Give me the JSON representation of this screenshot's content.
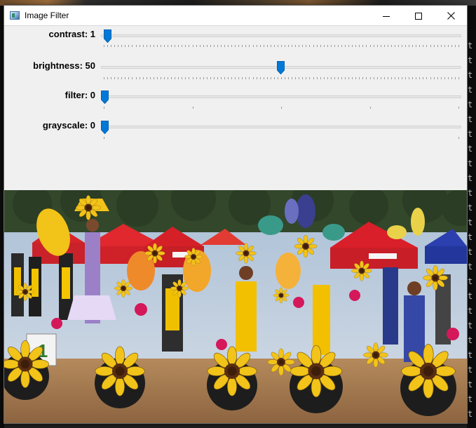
{
  "window": {
    "title": "Image Filter",
    "caption_minimize": "—",
    "caption_maximize": "☐",
    "caption_close": "✕"
  },
  "sliders": [
    {
      "label": "contrast: 1",
      "value": 1,
      "min": 0,
      "max": 100
    },
    {
      "label": "brightness: 50",
      "value": 50,
      "min": 0,
      "max": 100
    },
    {
      "label": "filter: 0",
      "value": 0,
      "min": 0,
      "max": 4
    },
    {
      "label": "grayscale: 0",
      "value": 0,
      "min": 0,
      "max": 1
    }
  ],
  "background_terminal_char": "t",
  "colors": {
    "accent": "#0078d7",
    "window_bg": "#f0f0f0",
    "titlebar_bg": "#ffffff"
  },
  "image": {
    "subject": "festival parade with sunflower costumes and red tents",
    "sign_text": "1"
  }
}
